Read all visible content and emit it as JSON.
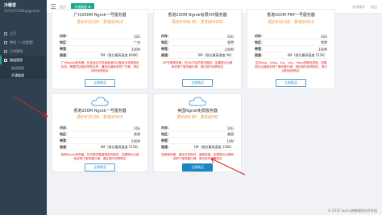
{
  "sidebar": {
    "username": "冷暖君",
    "email": "1151475385@qq.com",
    "items": [
      {
        "label": "主页"
      },
      {
        "label": "教程（一定要看）"
      },
      {
        "label": "订单管理"
      },
      {
        "label": "隧道管理"
      }
    ],
    "sub_items": [
      {
        "label": "隧道管理"
      },
      {
        "label": "开通隧道"
      }
    ]
  },
  "topbar": {
    "home_tab": "首页",
    "active_tab": "开通隧道 ✖",
    "actions": [
      "关闭操作",
      "退出"
    ]
  },
  "cards": [
    {
      "title": "广州200M Ngrok一号服务器",
      "price": "原价¥10.00　折扣价¥10",
      "rows": [
        {
          "label": "内存：",
          "value": "16G"
        },
        {
          "label": "地区：",
          "value": "广州"
        },
        {
          "label": "带宽：",
          "value": "200M"
        },
        {
          "label": "限速：",
          "value": "5M（限位最高速度 640K）"
        }
      ],
      "desc": "广州Ngrok服务器，仅仅适合开发者使用但以备用也非常稳定比如，需要的话就赶快购买吧，通信出错就说明了已满，请过段时间再购买",
      "button": "立即购买"
    },
    {
      "title": "香港200M Ngrok有限VIP服务器",
      "price": "原价¥200.00　折扣价¥200",
      "rows": [
        {
          "label": "内存：",
          "value": "16G"
        },
        {
          "label": "地区：",
          "value": "香港"
        },
        {
          "label": "带宽：",
          "value": "200M"
        },
        {
          "label": "限速：",
          "value": "0M（限位最高速度 0K）"
        }
      ],
      "desc": "VIP专属服务器，仅对VIP会员提供服务，如果提示出错就说明了服务器已满，请过段时间再购买",
      "button": "立即购买"
    },
    {
      "title": "香港200M FRP一号服务器",
      "price": "原价¥10.00　折扣价¥10",
      "rows": [
        {
          "label": "内存：",
          "value": "16G"
        },
        {
          "label": "地区：",
          "value": "香港"
        },
        {
          "label": "带宽：",
          "value": "200M"
        },
        {
          "label": "限速：",
          "value": "4M（限位最高速度 512K）"
        }
      ],
      "desc": "支持http、https、tcp、udp、https的服务类型，如果提示出错就说明了服务器已满，请过段时间再购买，请过段时间再购买",
      "button": "立即购买"
    },
    {
      "title": "香港200M Ngrok一号服务器",
      "price": "原价¥10.00　折扣价¥10",
      "rows": [
        {
          "label": "内存：",
          "value": "16G"
        },
        {
          "label": "地区：",
          "value": "香港"
        },
        {
          "label": "带宽：",
          "value": "200M"
        },
        {
          "label": "限速：",
          "value": "4M（限位最高速度 512K）"
        }
      ],
      "desc": "香港Ngrok服务器，仅仅提供高速稳定的服务，如果提示出错就说明了服务器已满，请过段时间再购买",
      "button": "立即购买"
    },
    {
      "title": "美国Ngrok免费服务器",
      "price": "原价¥0.00　折扣价¥0",
      "rows": [
        {
          "label": "内存：",
          "value": "16G"
        },
        {
          "label": "地区：",
          "value": "美国"
        },
        {
          "label": "带宽：",
          "value": "10M"
        },
        {
          "label": "限速：",
          "value": "1M（限位最高速度 128K）"
        }
      ],
      "desc": "免费服务器，满足日常测试，速度较慢，如果提示出错就说明了服务器已满，请过段时间再购买",
      "button": "立即购买"
    }
  ],
  "footer": "© 2015 Sunny神数据科技开发组",
  "colors": {
    "sidebar": "#2f4050",
    "accent": "#19aa8d",
    "price": "#ed8a28",
    "desc": "#e02020",
    "button": "#1c84c6",
    "annotation": "#d9251d"
  }
}
